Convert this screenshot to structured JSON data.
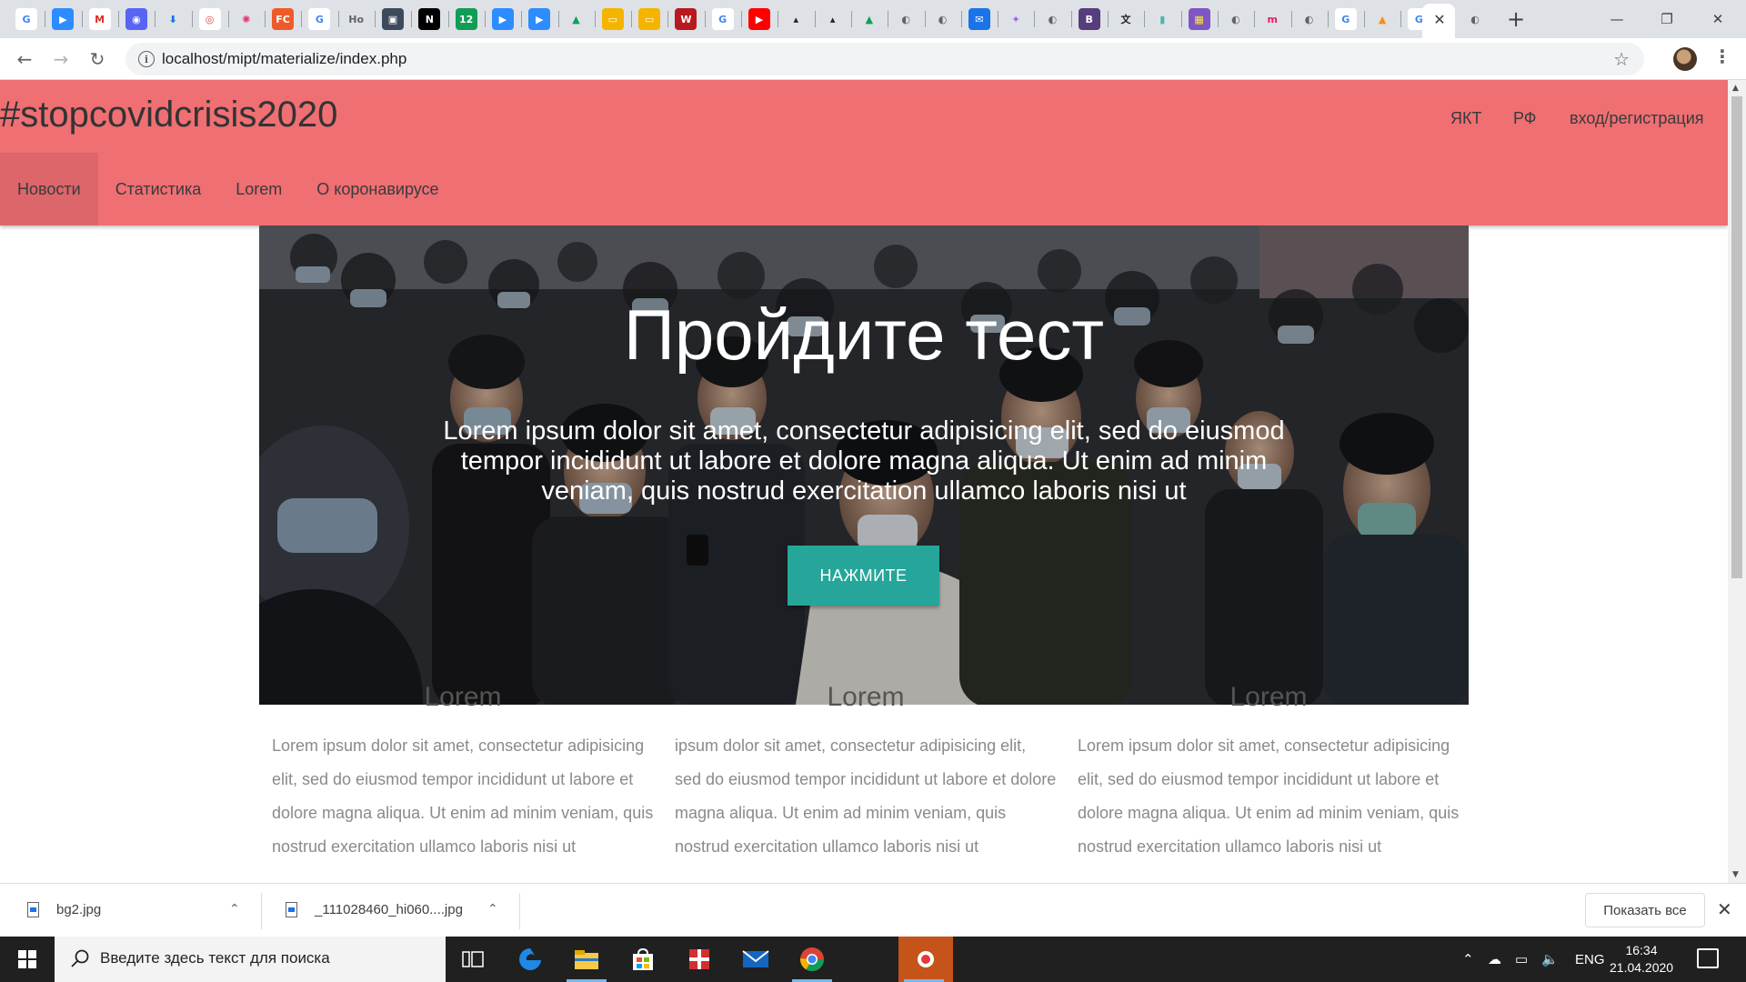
{
  "browser": {
    "url": "localhost/mipt/materialize/index.php",
    "tab_close": "✕",
    "tab_favicons": [
      {
        "name": "google-icon",
        "glyph": "G",
        "bg": "#ffffff",
        "fg": "#4285f4"
      },
      {
        "name": "zoom-icon",
        "glyph": "▶",
        "bg": "#2d8cff",
        "fg": "#ffffff"
      },
      {
        "name": "gmail-icon",
        "glyph": "M",
        "bg": "#ffffff",
        "fg": "#d93025"
      },
      {
        "name": "discord-icon",
        "glyph": "◉",
        "bg": "#5865f2",
        "fg": "#ffffff"
      },
      {
        "name": "download-icon",
        "glyph": "⬇",
        "bg": "#dee1e6",
        "fg": "#1a73e8"
      },
      {
        "name": "chrome-icon",
        "glyph": "◎",
        "bg": "#ffffff",
        "fg": "#db4437"
      },
      {
        "name": "flower-icon",
        "glyph": "✺",
        "bg": "#dee1e6",
        "fg": "#e8336b"
      },
      {
        "name": "fc-icon",
        "glyph": "FC",
        "bg": "#f05a28",
        "fg": "#ffffff"
      },
      {
        "name": "google-icon",
        "glyph": "G",
        "bg": "#ffffff",
        "fg": "#4285f4"
      },
      {
        "name": "text-icon",
        "glyph": "Hо",
        "bg": "#dee1e6",
        "fg": "#5f6368"
      },
      {
        "name": "chat-icon",
        "glyph": "▣",
        "bg": "#3c4a5c",
        "fg": "#ffffff"
      },
      {
        "name": "notion-icon",
        "glyph": "N",
        "bg": "#000000",
        "fg": "#ffffff"
      },
      {
        "name": "number-icon",
        "glyph": "12",
        "bg": "#0f9d58",
        "fg": "#ffffff"
      },
      {
        "name": "zoom-icon",
        "glyph": "▶",
        "bg": "#2d8cff",
        "fg": "#ffffff"
      },
      {
        "name": "zoom-icon",
        "glyph": "▶",
        "bg": "#2d8cff",
        "fg": "#ffffff"
      },
      {
        "name": "drive-icon",
        "glyph": "▲",
        "bg": "#dee1e6",
        "fg": "#0f9d58"
      },
      {
        "name": "slides-icon",
        "glyph": "▭",
        "bg": "#f4b400",
        "fg": "#ffffff"
      },
      {
        "name": "slides-icon",
        "glyph": "▭",
        "bg": "#f4b400",
        "fg": "#ffffff"
      },
      {
        "name": "w-icon",
        "glyph": "W",
        "bg": "#b7191e",
        "fg": "#ffffff"
      },
      {
        "name": "google-icon",
        "glyph": "G",
        "bg": "#ffffff",
        "fg": "#4285f4"
      },
      {
        "name": "youtube-icon",
        "glyph": "▶",
        "bg": "#ff0000",
        "fg": "#ffffff"
      },
      {
        "name": "signal-icon",
        "glyph": "▴",
        "bg": "#dee1e6",
        "fg": "#202124"
      },
      {
        "name": "signal-icon",
        "glyph": "▴",
        "bg": "#dee1e6",
        "fg": "#202124"
      },
      {
        "name": "drive-icon",
        "glyph": "▲",
        "bg": "#dee1e6",
        "fg": "#0f9d58"
      },
      {
        "name": "globe-icon",
        "glyph": "◐",
        "bg": "#dee1e6",
        "fg": "#5f6368"
      },
      {
        "name": "globe-icon",
        "glyph": "◐",
        "bg": "#dee1e6",
        "fg": "#5f6368"
      },
      {
        "name": "mail-icon",
        "glyph": "✉",
        "bg": "#1a73e8",
        "fg": "#ffffff"
      },
      {
        "name": "figma-icon",
        "glyph": "✦",
        "bg": "#dee1e6",
        "fg": "#a259ff"
      },
      {
        "name": "globe-icon",
        "glyph": "◐",
        "bg": "#dee1e6",
        "fg": "#5f6368"
      },
      {
        "name": "bootstrap-icon",
        "glyph": "B",
        "bg": "#563d7c",
        "fg": "#ffffff"
      },
      {
        "name": "translate-icon",
        "glyph": "文",
        "bg": "#dee1e6",
        "fg": "#202124"
      },
      {
        "name": "bars-icon",
        "glyph": "▮",
        "bg": "#dee1e6",
        "fg": "#4db6ac"
      },
      {
        "name": "rainbow-icon",
        "glyph": "▦",
        "bg": "#7e57c2",
        "fg": "#ffeb3b"
      },
      {
        "name": "globe-icon",
        "glyph": "◐",
        "bg": "#dee1e6",
        "fg": "#5f6368"
      },
      {
        "name": "m-icon",
        "glyph": "m",
        "bg": "#dee1e6",
        "fg": "#e91e63"
      },
      {
        "name": "globe-icon",
        "glyph": "◐",
        "bg": "#dee1e6",
        "fg": "#5f6368"
      },
      {
        "name": "google-icon",
        "glyph": "G",
        "bg": "#ffffff",
        "fg": "#4285f4"
      },
      {
        "name": "pma-icon",
        "glyph": "▲",
        "bg": "#dee1e6",
        "fg": "#f29111"
      },
      {
        "name": "google-icon",
        "glyph": "G",
        "bg": "#ffffff",
        "fg": "#4285f4"
      }
    ],
    "after_tab_favicon": {
      "name": "globe-icon",
      "glyph": "◐",
      "bg": "#dee1e6",
      "fg": "#5f6368"
    }
  },
  "site": {
    "brand": "#stopcovidcrisis2020",
    "top_links": [
      "ЯКТ",
      "РФ",
      "вход/регистрация"
    ],
    "nav": [
      {
        "label": "Новости",
        "active": true
      },
      {
        "label": "Статистика",
        "active": false
      },
      {
        "label": "Lorem",
        "active": false
      },
      {
        "label": "О коронавирусе",
        "active": false
      }
    ],
    "accent": "#ef6f73"
  },
  "hero": {
    "title": "Пройдите тест",
    "text": "Lorem ipsum dolor sit amet, consectetur adipisicing elit, sed do eiusmod tempor incididunt ut labore et dolore magna aliqua. Ut enim ad minim veniam, quis nostrud exercitation ullamco laboris nisi ut",
    "button": "НАЖМИТЕ",
    "button_color": "#26a69a"
  },
  "features": [
    {
      "title": "Lorem",
      "text": "Lorem ipsum dolor sit amet, consectetur adipisicing elit, sed do eiusmod tempor incididunt ut labore et dolore magna aliqua. Ut enim ad minim veniam, quis nostrud exercitation ullamco laboris nisi ut"
    },
    {
      "title": "Lorem",
      "text": "ipsum dolor sit amet, consectetur adipisicing elit, sed do eiusmod tempor incididunt ut labore et dolore magna aliqua. Ut enim ad minim veniam, quis nostrud exercitation ullamco laboris nisi ut"
    },
    {
      "title": "Lorem",
      "text": "Lorem ipsum dolor sit amet, consectetur adipisicing elit, sed do eiusmod tempor incididunt ut labore et dolore magna aliqua. Ut enim ad minim veniam, quis nostrud exercitation ullamco laboris nisi ut"
    }
  ],
  "downloads": {
    "items": [
      "bg2.jpg",
      "_111028460_hi060....jpg"
    ],
    "show_all": "Показать все"
  },
  "taskbar": {
    "search_placeholder": "Введите здесь текст для поиска",
    "lang": "ENG",
    "time": "16:34",
    "date": "21.04.2020"
  }
}
